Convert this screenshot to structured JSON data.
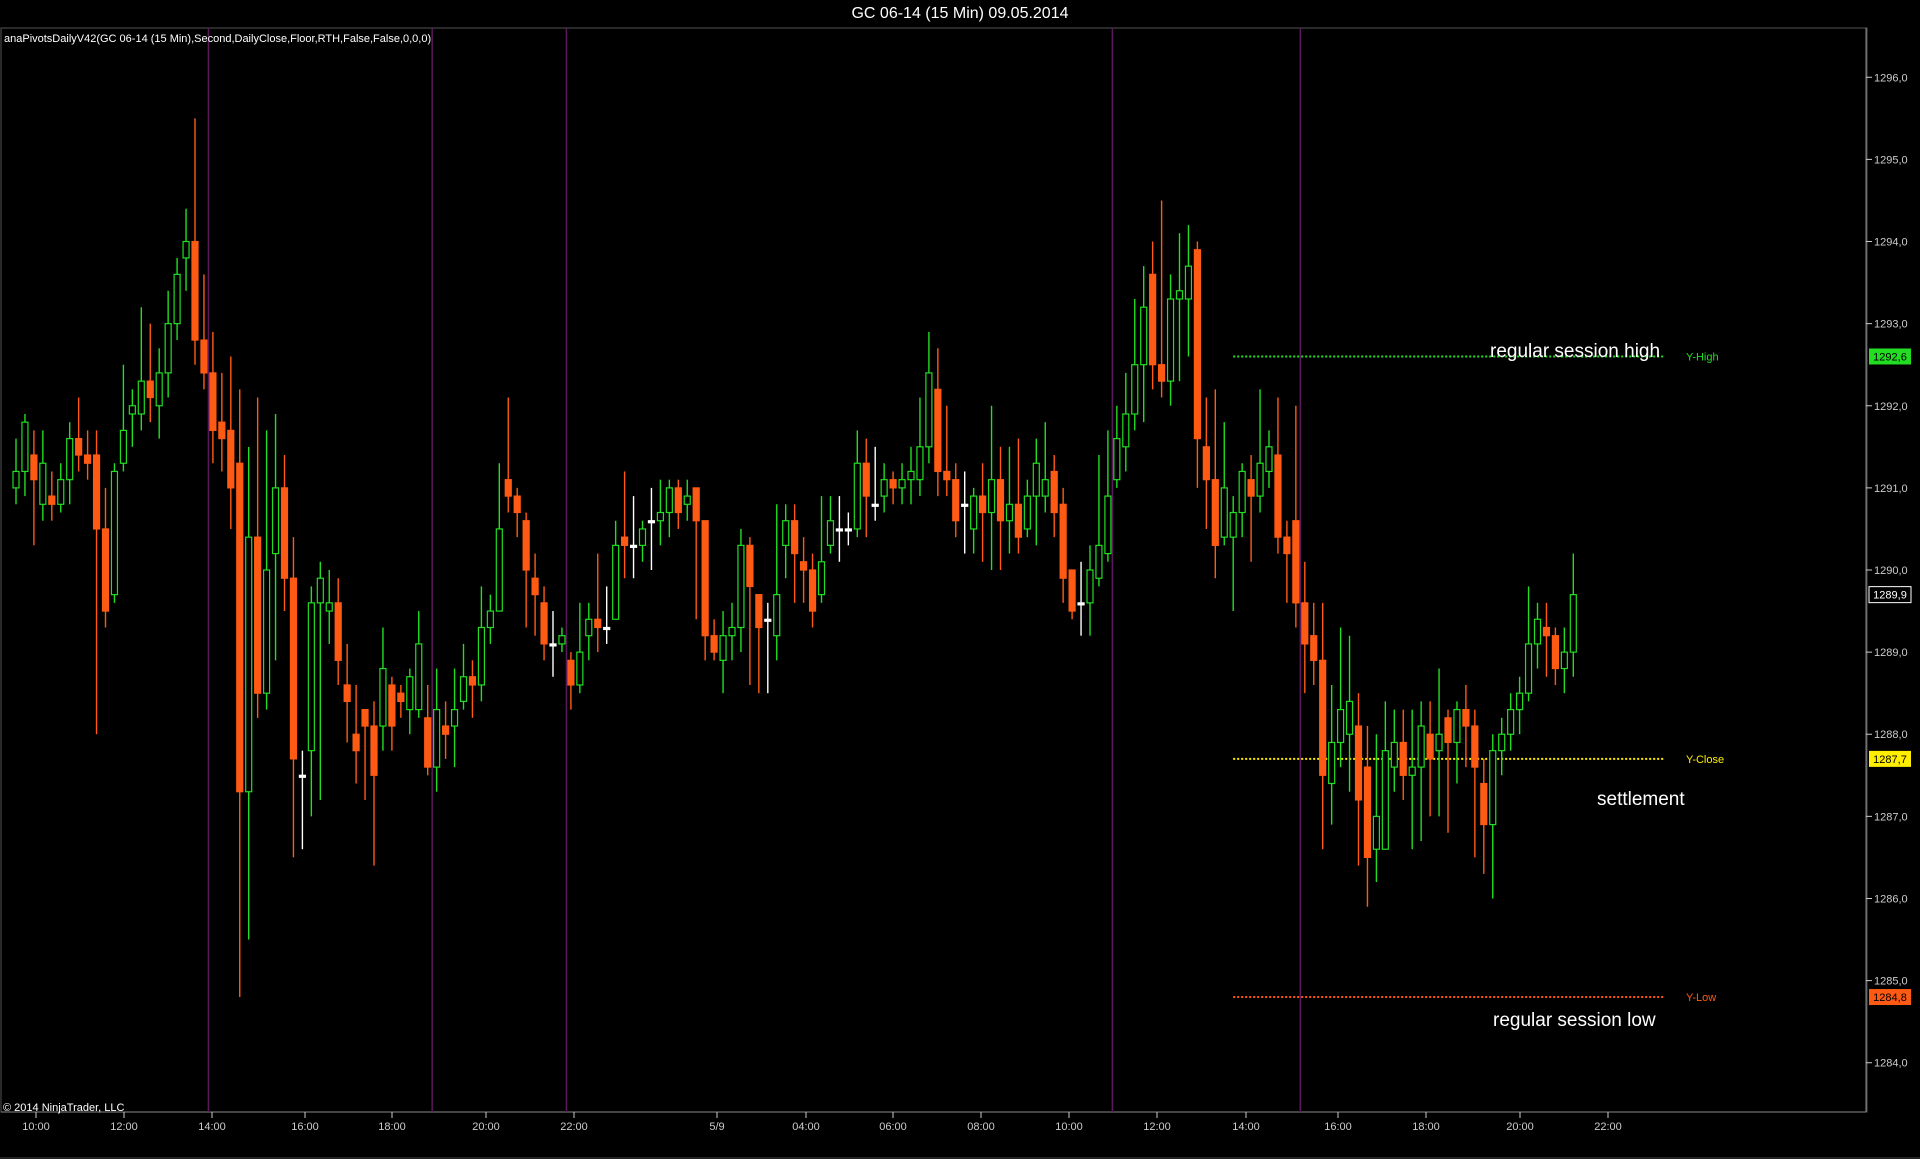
{
  "window": {
    "title": "GC 06-14 (15 Min)  09.05.2014"
  },
  "indicator_label": "anaPivotsDailyV42(GC 06-14 (15 Min),Second,DailyClose,Floor,RTH,False,False,0,0,0)",
  "copyright": "© 2014 NinjaTrader, LLC",
  "colors": {
    "up": "#22dd22",
    "down": "#ff5a14",
    "doji": "#ffffff",
    "session_line": "#5a1a5a",
    "y_high": "#22dd22",
    "y_close": "#ffee00",
    "y_low": "#ff5a14",
    "axis": "#cccccc"
  },
  "annotations": {
    "session_high": "regular session high",
    "settlement": "settlement",
    "session_low": "regular session low"
  },
  "chart_data": {
    "type": "candlestick",
    "title": "GC 06-14 (15 Min)  09.05.2014",
    "ylim": [
      1283.4,
      1296.6
    ],
    "y_ticks": [
      "1284,0",
      "1285,0",
      "1286,0",
      "1287,0",
      "1288,0",
      "1289,0",
      "1290,0",
      "1291,0",
      "1292,0",
      "1293,0",
      "1294,0",
      "1295,0",
      "1296,0"
    ],
    "x_ticks": [
      "10:00",
      "12:00",
      "14:00",
      "16:00",
      "18:00",
      "20:00",
      "22:00",
      "5/9",
      "04:00",
      "06:00",
      "08:00",
      "10:00",
      "12:00",
      "14:00",
      "16:00",
      "18:00",
      "20:00",
      "22:00"
    ],
    "session_breaks_bar_index": [
      22,
      47,
      62,
      123,
      144
    ],
    "levels": [
      {
        "label": "Y-High",
        "value": 1292.6,
        "marker": "1292,6"
      },
      {
        "label": "Y-Close",
        "value": 1287.7,
        "marker": "1287,7"
      },
      {
        "label": "Y-Low",
        "value": 1284.8,
        "marker": "1284,8"
      }
    ],
    "last_price_marker": "1289,9",
    "levels_start_bar_index": 136,
    "bars": [
      [
        1291.0,
        1291.2,
        1291.6,
        1290.8
      ],
      [
        1291.2,
        1291.8,
        1291.9,
        1290.9
      ],
      [
        1291.4,
        1291.1,
        1291.7,
        1290.3
      ],
      [
        1290.8,
        1291.3,
        1291.7,
        1290.6
      ],
      [
        1290.9,
        1290.8,
        1291.2,
        1290.6
      ],
      [
        1290.8,
        1291.1,
        1291.3,
        1290.7
      ],
      [
        1291.1,
        1291.6,
        1291.8,
        1290.8
      ],
      [
        1291.6,
        1291.4,
        1292.1,
        1291.2
      ],
      [
        1291.4,
        1291.3,
        1291.7,
        1291.1
      ],
      [
        1291.4,
        1290.5,
        1291.7,
        1288.0
      ],
      [
        1290.5,
        1289.5,
        1291.0,
        1289.3
      ],
      [
        1289.7,
        1291.2,
        1291.3,
        1289.6
      ],
      [
        1291.3,
        1291.7,
        1292.5,
        1291.2
      ],
      [
        1291.9,
        1292.0,
        1292.2,
        1291.5
      ],
      [
        1291.9,
        1292.3,
        1293.2,
        1291.7
      ],
      [
        1292.3,
        1292.1,
        1293.0,
        1291.8
      ],
      [
        1292.0,
        1292.4,
        1292.7,
        1291.6
      ],
      [
        1292.4,
        1293.0,
        1293.4,
        1292.1
      ],
      [
        1293.0,
        1293.6,
        1293.8,
        1292.8
      ],
      [
        1293.8,
        1294.0,
        1294.4,
        1293.4
      ],
      [
        1294.0,
        1292.8,
        1295.5,
        1292.5
      ],
      [
        1292.8,
        1292.4,
        1293.6,
        1292.2
      ],
      [
        1292.4,
        1291.7,
        1292.9,
        1291.3
      ],
      [
        1291.8,
        1291.6,
        1292.4,
        1291.2
      ],
      [
        1291.7,
        1291.0,
        1292.6,
        1290.5
      ],
      [
        1291.3,
        1287.3,
        1292.2,
        1284.8
      ],
      [
        1287.3,
        1290.4,
        1291.5,
        1285.5
      ],
      [
        1290.4,
        1288.5,
        1292.1,
        1288.2
      ],
      [
        1288.5,
        1290.0,
        1291.7,
        1288.3
      ],
      [
        1290.2,
        1291.0,
        1291.9,
        1288.9
      ],
      [
        1291.0,
        1289.9,
        1291.4,
        1289.5
      ],
      [
        1289.9,
        1287.7,
        1290.4,
        1286.5
      ],
      [
        1287.5,
        1287.5,
        1287.8,
        1286.6
      ],
      [
        1287.8,
        1289.6,
        1289.8,
        1287.0
      ],
      [
        1289.6,
        1289.9,
        1290.1,
        1287.2
      ],
      [
        1289.5,
        1289.6,
        1290.0,
        1289.1
      ],
      [
        1289.6,
        1288.9,
        1289.9,
        1288.6
      ],
      [
        1288.6,
        1288.4,
        1289.1,
        1287.9
      ],
      [
        1288.0,
        1287.8,
        1288.6,
        1287.4
      ],
      [
        1288.3,
        1288.1,
        1288.3,
        1287.2
      ],
      [
        1288.1,
        1287.5,
        1288.4,
        1286.4
      ],
      [
        1288.1,
        1288.8,
        1289.3,
        1287.8
      ],
      [
        1288.6,
        1288.1,
        1288.7,
        1287.8
      ],
      [
        1288.5,
        1288.4,
        1288.6,
        1288.2
      ],
      [
        1288.3,
        1288.7,
        1288.8,
        1288.0
      ],
      [
        1288.3,
        1289.1,
        1289.5,
        1288.2
      ],
      [
        1288.2,
        1287.6,
        1288.6,
        1287.5
      ],
      [
        1287.6,
        1288.3,
        1288.8,
        1287.3
      ],
      [
        1288.1,
        1288.0,
        1288.4,
        1287.7
      ],
      [
        1288.1,
        1288.3,
        1288.8,
        1287.6
      ],
      [
        1288.4,
        1288.7,
        1289.1,
        1288.3
      ],
      [
        1288.7,
        1288.6,
        1288.9,
        1288.2
      ],
      [
        1288.6,
        1289.3,
        1289.8,
        1288.4
      ],
      [
        1289.3,
        1289.5,
        1289.7,
        1289.1
      ],
      [
        1289.5,
        1290.5,
        1291.3,
        1289.6
      ],
      [
        1291.1,
        1290.9,
        1292.1,
        1290.7
      ],
      [
        1290.9,
        1290.7,
        1291.0,
        1290.4
      ],
      [
        1290.6,
        1290.0,
        1290.7,
        1289.3
      ],
      [
        1289.9,
        1289.7,
        1290.2,
        1289.2
      ],
      [
        1289.6,
        1289.1,
        1289.8,
        1288.9
      ],
      [
        1289.1,
        1289.1,
        1289.5,
        1288.7
      ],
      [
        1289.1,
        1289.2,
        1289.3,
        1289.0
      ],
      [
        1288.9,
        1288.6,
        1289.0,
        1288.3
      ],
      [
        1288.6,
        1289.0,
        1289.6,
        1288.5
      ],
      [
        1289.2,
        1289.4,
        1289.6,
        1288.9
      ],
      [
        1289.4,
        1289.3,
        1290.2,
        1289.0
      ],
      [
        1289.3,
        1289.3,
        1289.8,
        1289.1
      ],
      [
        1289.4,
        1290.3,
        1290.6,
        1289.4
      ],
      [
        1290.4,
        1290.3,
        1291.2,
        1289.9
      ],
      [
        1290.3,
        1290.3,
        1290.9,
        1289.9
      ],
      [
        1290.3,
        1290.5,
        1290.6,
        1290.1
      ],
      [
        1290.6,
        1290.6,
        1291.0,
        1290.0
      ],
      [
        1290.6,
        1290.7,
        1291.1,
        1290.3
      ],
      [
        1290.7,
        1291.0,
        1291.1,
        1290.4
      ],
      [
        1291.0,
        1290.7,
        1291.1,
        1290.5
      ],
      [
        1290.8,
        1290.9,
        1291.1,
        1290.6
      ],
      [
        1291.0,
        1290.6,
        1291.0,
        1289.4
      ],
      [
        1290.6,
        1289.2,
        1290.6,
        1288.9
      ],
      [
        1289.2,
        1289.0,
        1289.4,
        1288.9
      ],
      [
        1288.9,
        1289.2,
        1289.5,
        1288.5
      ],
      [
        1289.2,
        1289.3,
        1289.6,
        1288.9
      ],
      [
        1289.3,
        1290.3,
        1290.5,
        1289.0
      ],
      [
        1290.3,
        1289.8,
        1290.4,
        1288.6
      ],
      [
        1289.7,
        1289.3,
        1289.7,
        1288.5
      ],
      [
        1289.4,
        1289.4,
        1289.6,
        1288.5
      ],
      [
        1289.2,
        1289.7,
        1290.8,
        1288.9
      ],
      [
        1290.3,
        1290.6,
        1290.8,
        1289.9
      ],
      [
        1290.6,
        1290.2,
        1290.8,
        1289.6
      ],
      [
        1290.1,
        1290.0,
        1290.4,
        1289.6
      ],
      [
        1290.0,
        1289.5,
        1290.2,
        1289.3
      ],
      [
        1289.7,
        1290.1,
        1290.9,
        1289.6
      ],
      [
        1290.3,
        1290.6,
        1290.9,
        1290.2
      ],
      [
        1290.5,
        1290.5,
        1290.9,
        1290.1
      ],
      [
        1290.5,
        1290.5,
        1290.7,
        1290.3
      ],
      [
        1290.5,
        1291.3,
        1291.7,
        1290.4
      ],
      [
        1291.3,
        1290.9,
        1291.6,
        1290.4
      ],
      [
        1290.8,
        1290.8,
        1291.5,
        1290.6
      ],
      [
        1290.9,
        1291.1,
        1291.3,
        1290.7
      ],
      [
        1291.1,
        1291.0,
        1291.2,
        1290.8
      ],
      [
        1291.0,
        1291.1,
        1291.3,
        1290.8
      ],
      [
        1291.1,
        1291.2,
        1291.5,
        1290.8
      ],
      [
        1291.1,
        1291.5,
        1292.1,
        1290.9
      ],
      [
        1291.5,
        1292.4,
        1292.9,
        1291.3
      ],
      [
        1292.2,
        1291.2,
        1292.7,
        1290.9
      ],
      [
        1291.2,
        1291.1,
        1292.0,
        1290.9
      ],
      [
        1291.1,
        1290.6,
        1291.3,
        1290.4
      ],
      [
        1290.8,
        1290.8,
        1291.2,
        1290.2
      ],
      [
        1290.5,
        1290.9,
        1291.0,
        1290.2
      ],
      [
        1290.9,
        1290.7,
        1291.3,
        1290.1
      ],
      [
        1290.7,
        1291.1,
        1292.0,
        1290.0
      ],
      [
        1291.1,
        1290.6,
        1291.5,
        1290.0
      ],
      [
        1290.6,
        1290.8,
        1291.5,
        1290.2
      ],
      [
        1290.8,
        1290.4,
        1291.6,
        1290.2
      ],
      [
        1290.5,
        1290.9,
        1291.1,
        1290.4
      ],
      [
        1290.9,
        1291.3,
        1291.6,
        1290.3
      ],
      [
        1290.9,
        1291.1,
        1291.8,
        1290.7
      ],
      [
        1291.2,
        1290.7,
        1291.4,
        1290.4
      ],
      [
        1290.8,
        1289.9,
        1291.0,
        1289.6
      ],
      [
        1290.0,
        1289.5,
        1290.0,
        1289.4
      ],
      [
        1289.6,
        1289.6,
        1290.1,
        1289.2
      ],
      [
        1289.6,
        1290.0,
        1290.3,
        1289.2
      ],
      [
        1289.9,
        1290.3,
        1291.4,
        1289.8
      ],
      [
        1290.2,
        1290.9,
        1291.7,
        1290.1
      ],
      [
        1291.1,
        1291.6,
        1292.0,
        1291.0
      ],
      [
        1291.5,
        1291.9,
        1292.4,
        1291.2
      ],
      [
        1291.9,
        1292.5,
        1293.3,
        1291.7
      ],
      [
        1292.5,
        1293.2,
        1293.7,
        1291.8
      ],
      [
        1293.6,
        1292.5,
        1294.0,
        1292.2
      ],
      [
        1292.5,
        1292.3,
        1294.5,
        1292.1
      ],
      [
        1292.3,
        1293.3,
        1293.6,
        1292.0
      ],
      [
        1293.3,
        1293.4,
        1294.1,
        1292.3
      ],
      [
        1293.3,
        1293.7,
        1294.2,
        1292.6
      ],
      [
        1293.9,
        1291.6,
        1294.0,
        1291.0
      ],
      [
        1291.5,
        1291.1,
        1292.1,
        1290.5
      ],
      [
        1291.1,
        1290.3,
        1292.2,
        1289.9
      ],
      [
        1290.4,
        1291.0,
        1291.8,
        1290.3
      ],
      [
        1290.4,
        1290.7,
        1290.9,
        1289.5
      ],
      [
        1290.7,
        1291.2,
        1291.3,
        1290.4
      ],
      [
        1291.1,
        1290.9,
        1291.4,
        1290.1
      ],
      [
        1290.9,
        1291.3,
        1292.2,
        1290.7
      ],
      [
        1291.2,
        1291.5,
        1291.7,
        1291.0
      ],
      [
        1291.4,
        1290.4,
        1292.1,
        1290.2
      ],
      [
        1290.4,
        1290.2,
        1290.6,
        1289.6
      ],
      [
        1290.6,
        1289.6,
        1292.0,
        1289.3
      ],
      [
        1289.6,
        1289.1,
        1290.1,
        1288.5
      ],
      [
        1289.2,
        1288.9,
        1289.6,
        1288.6
      ],
      [
        1288.9,
        1287.5,
        1289.6,
        1286.6
      ],
      [
        1287.4,
        1287.9,
        1288.6,
        1286.9
      ],
      [
        1287.9,
        1288.3,
        1289.3,
        1287.6
      ],
      [
        1288.0,
        1288.4,
        1289.2,
        1287.3
      ],
      [
        1288.1,
        1287.2,
        1288.5,
        1286.4
      ],
      [
        1287.6,
        1286.5,
        1288.1,
        1285.9
      ],
      [
        1286.6,
        1287.0,
        1288.0,
        1286.2
      ],
      [
        1286.6,
        1287.8,
        1288.4,
        1286.7
      ],
      [
        1287.6,
        1287.9,
        1288.3,
        1287.3
      ],
      [
        1287.9,
        1287.5,
        1288.3,
        1287.2
      ],
      [
        1287.5,
        1287.6,
        1288.3,
        1286.6
      ],
      [
        1287.6,
        1288.1,
        1288.4,
        1286.7
      ],
      [
        1288.0,
        1287.7,
        1288.4,
        1287.0
      ],
      [
        1287.8,
        1288.0,
        1288.8,
        1287.0
      ],
      [
        1288.2,
        1287.9,
        1288.3,
        1286.8
      ],
      [
        1287.9,
        1288.3,
        1288.4,
        1287.4
      ],
      [
        1288.3,
        1288.1,
        1288.6,
        1287.6
      ],
      [
        1288.1,
        1287.6,
        1288.3,
        1286.5
      ],
      [
        1287.4,
        1286.9,
        1287.7,
        1286.3
      ],
      [
        1286.9,
        1287.8,
        1288.0,
        1286.0
      ],
      [
        1287.8,
        1288.0,
        1288.2,
        1287.5
      ],
      [
        1288.0,
        1288.3,
        1288.5,
        1287.8
      ],
      [
        1288.3,
        1288.5,
        1288.7,
        1288.0
      ],
      [
        1288.5,
        1289.1,
        1289.8,
        1288.4
      ],
      [
        1289.1,
        1289.4,
        1289.6,
        1288.8
      ],
      [
        1289.3,
        1289.2,
        1289.6,
        1288.7
      ],
      [
        1289.2,
        1288.8,
        1289.3,
        1288.6
      ],
      [
        1288.8,
        1289.0,
        1289.3,
        1288.5
      ],
      [
        1289.0,
        1289.7,
        1290.2,
        1288.7
      ]
    ]
  }
}
